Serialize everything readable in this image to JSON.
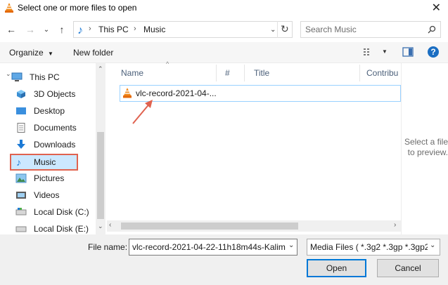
{
  "window": {
    "title": "Select one or more files to open"
  },
  "address": {
    "crumbs": [
      "This PC",
      "Music"
    ]
  },
  "search": {
    "placeholder": "Search Music"
  },
  "toolbar": {
    "organize_label": "Organize",
    "new_folder_label": "New folder"
  },
  "sidebar": {
    "items": [
      {
        "label": "This PC",
        "icon": "monitor-icon"
      },
      {
        "label": "3D Objects",
        "icon": "cube-icon"
      },
      {
        "label": "Desktop",
        "icon": "desktop-icon"
      },
      {
        "label": "Documents",
        "icon": "documents-icon"
      },
      {
        "label": "Downloads",
        "icon": "download-arrow-icon"
      },
      {
        "label": "Music",
        "icon": "music-note-icon",
        "selected": true
      },
      {
        "label": "Pictures",
        "icon": "pictures-icon"
      },
      {
        "label": "Videos",
        "icon": "videos-icon"
      },
      {
        "label": "Local Disk (C:)",
        "icon": "drive-icon"
      },
      {
        "label": "Local Disk (E:)",
        "icon": "drive-icon"
      }
    ]
  },
  "columns": [
    "Name",
    "#",
    "Title",
    "Contribu"
  ],
  "files": [
    {
      "name": "vlc-record-2021-04-..."
    }
  ],
  "preview": {
    "line1": "Select a file",
    "line2": "to preview."
  },
  "footer": {
    "file_name_label": "File name:",
    "file_name_value": "vlc-record-2021-04-22-11h18m44s-Kalim",
    "file_type_value": "Media Files ( *.3g2 *.3gp *.3gp2",
    "open_label": "Open",
    "cancel_label": "Cancel"
  },
  "colors": {
    "accent": "#0078d7",
    "highlight": "#e0624f",
    "selection": "#cce8ff"
  }
}
